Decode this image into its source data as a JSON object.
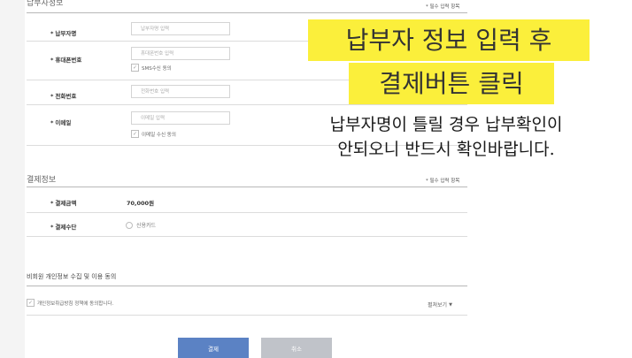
{
  "donor_section": {
    "title": "납부자정보",
    "required_note": "* 필수 입력 항목",
    "fields": {
      "name": {
        "label": "납부자명",
        "placeholder": "납부자명 입력"
      },
      "mobile": {
        "label": "휴대폰번호",
        "placeholder": "휴대폰번호 입력",
        "consent": "SMS수신 동의"
      },
      "phone": {
        "label": "전화번호",
        "placeholder": "전화번호 입력"
      },
      "email": {
        "label": "이메일",
        "placeholder": "이메일 입력",
        "consent": "이메일 수신 동의"
      }
    }
  },
  "payment_section": {
    "title": "결제정보",
    "required_note": "* 필수 입력 항목",
    "amount_label": "결제금액",
    "amount_value": "70,000원",
    "method_label": "결제수단",
    "method_option": "신용카드"
  },
  "privacy_section": {
    "title": "비회원 개인정보 수집 및 이용 동의",
    "consent_text": "개인정보취급방침 정책에 동의합니다.",
    "expand_label": "펼쳐보기"
  },
  "buttons": {
    "pay": "결제",
    "cancel": "취소"
  },
  "overlay": {
    "callout_line1": "납부자 정보 입력 후",
    "callout_line2": "결제버튼 클릭",
    "notice_line1": "납부자명이 틀릴 경우 납부확인이",
    "notice_line2": "안되오니 반드시 확인바랍니다."
  },
  "colors": {
    "callout_bg": "#fbef3b",
    "pay_button": "#5b82c4",
    "cancel_button": "#c0c3c9"
  }
}
